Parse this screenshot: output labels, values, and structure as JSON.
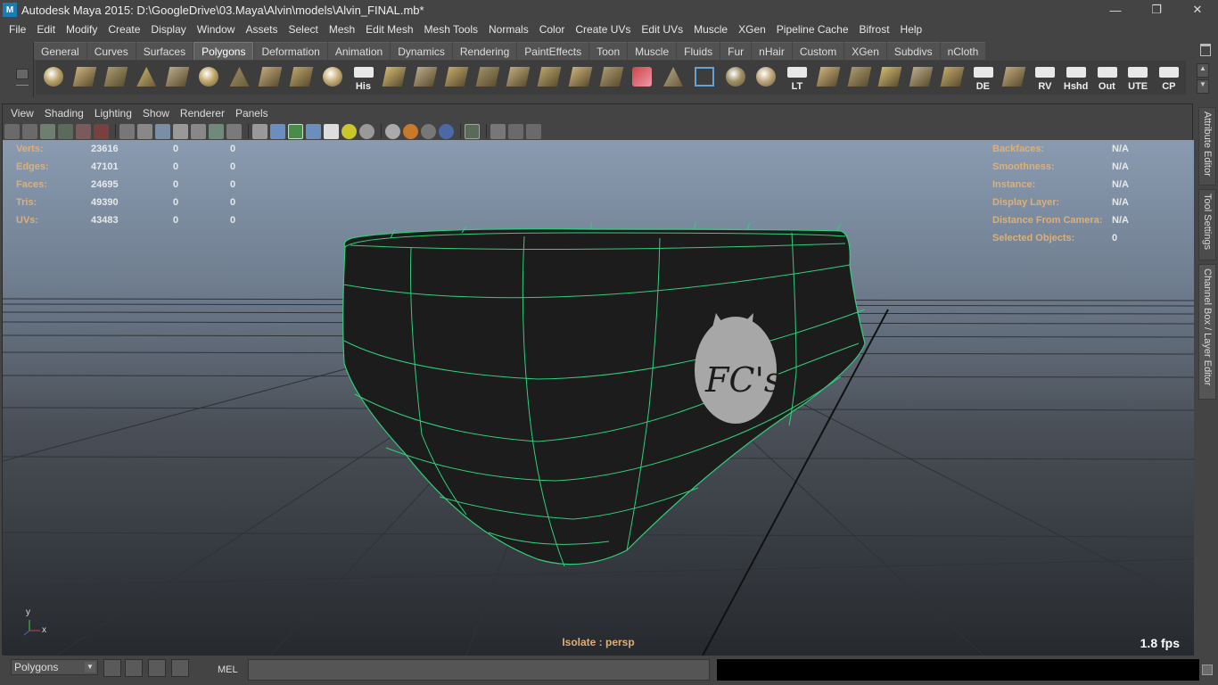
{
  "window": {
    "title": "Autodesk Maya 2015: D:\\GoogleDrive\\03.Maya\\Alvin\\models\\Alvin_FINAL.mb*",
    "app_icon": "M"
  },
  "window_buttons": {
    "minimize": "—",
    "restore": "❐",
    "close": "✕"
  },
  "menubar": [
    "File",
    "Edit",
    "Modify",
    "Create",
    "Display",
    "Window",
    "Assets",
    "Select",
    "Mesh",
    "Edit Mesh",
    "Mesh Tools",
    "Normals",
    "Color",
    "Create UVs",
    "Edit UVs",
    "Muscle",
    "XGen",
    "Pipeline Cache",
    "Bifrost",
    "Help"
  ],
  "shelf": {
    "tabs": [
      "General",
      "Curves",
      "Surfaces",
      "Polygons",
      "Deformation",
      "Animation",
      "Dynamics",
      "Rendering",
      "PaintEffects",
      "Toon",
      "Muscle",
      "Fluids",
      "Fur",
      "nHair",
      "Custom",
      "XGen",
      "Subdivs",
      "nCloth"
    ],
    "active_tab": "Polygons",
    "icons": [
      {
        "name": "poly-sphere-icon",
        "label": ""
      },
      {
        "name": "poly-cube-icon",
        "label": ""
      },
      {
        "name": "poly-cylinder-icon",
        "label": ""
      },
      {
        "name": "poly-cone-icon",
        "label": ""
      },
      {
        "name": "poly-plane-icon",
        "label": ""
      },
      {
        "name": "poly-torus-icon",
        "label": ""
      },
      {
        "name": "poly-pyramid-icon",
        "label": ""
      },
      {
        "name": "poly-pipe-icon",
        "label": ""
      },
      {
        "name": "create-polygon-tool-icon",
        "label": ""
      },
      {
        "name": "poly-sphere-mesh-icon",
        "label": ""
      },
      {
        "name": "history-icon",
        "label": "His"
      },
      {
        "name": "extrude-icon",
        "label": ""
      },
      {
        "name": "bevel-icon",
        "label": ""
      },
      {
        "name": "bridge-icon",
        "label": ""
      },
      {
        "name": "append-polygon-icon",
        "label": ""
      },
      {
        "name": "split-polygon-icon",
        "label": ""
      },
      {
        "name": "insert-edge-loop-icon",
        "label": ""
      },
      {
        "name": "offset-edge-loop-icon",
        "label": ""
      },
      {
        "name": "sculpt-geometry-icon",
        "label": ""
      },
      {
        "name": "paint-tool-icon",
        "label": ""
      },
      {
        "name": "lattice-icon",
        "label": ""
      },
      {
        "name": "soft-select-icon",
        "label": ""
      },
      {
        "name": "symmetry-icon",
        "label": ""
      },
      {
        "name": "mirror-geometry-icon",
        "label": ""
      },
      {
        "name": "lt-icon",
        "label": "LT"
      },
      {
        "name": "planar-mapping-icon",
        "label": ""
      },
      {
        "name": "cylindrical-mapping-icon",
        "label": ""
      },
      {
        "name": "spherical-mapping-icon",
        "label": ""
      },
      {
        "name": "automatic-mapping-icon",
        "label": ""
      },
      {
        "name": "uv-texture-editor-icon",
        "label": ""
      },
      {
        "name": "de-icon",
        "label": "DE"
      },
      {
        "name": "uv-layout-icon",
        "label": ""
      },
      {
        "name": "rv-icon",
        "label": "RV"
      },
      {
        "name": "hshd-icon",
        "label": "Hshd"
      },
      {
        "name": "out-icon",
        "label": "Out"
      },
      {
        "name": "ute-icon",
        "label": "UTE"
      },
      {
        "name": "cp-icon",
        "label": "CP"
      }
    ]
  },
  "panel_menu": [
    "View",
    "Shading",
    "Lighting",
    "Show",
    "Renderer",
    "Panels"
  ],
  "hud_left": [
    {
      "label": "Verts:",
      "v1": "23616",
      "v2": "0",
      "v3": "0"
    },
    {
      "label": "Edges:",
      "v1": "47101",
      "v2": "0",
      "v3": "0"
    },
    {
      "label": "Faces:",
      "v1": "24695",
      "v2": "0",
      "v3": "0"
    },
    {
      "label": "Tris:",
      "v1": "49390",
      "v2": "0",
      "v3": "0"
    },
    {
      "label": "UVs:",
      "v1": "43483",
      "v2": "0",
      "v3": "0"
    }
  ],
  "hud_right": [
    {
      "label": "Backfaces:",
      "value": "N/A"
    },
    {
      "label": "Smoothness:",
      "value": "N/A"
    },
    {
      "label": "Instance:",
      "value": "N/A"
    },
    {
      "label": "Display Layer:",
      "value": "N/A"
    },
    {
      "label": "Distance From Camera:",
      "value": "N/A"
    },
    {
      "label": "Selected Objects:",
      "value": "0"
    }
  ],
  "viewport": {
    "isolate_text": "Isolate : persp",
    "fps": "1.8 fps",
    "logo_text": "FC's",
    "axis_x": "x",
    "axis_y": "y"
  },
  "side_tabs": [
    "Attribute Editor",
    "Tool Settings",
    "Channel Box / Layer Editor"
  ],
  "statusbar": {
    "selection_mode": "Polygons",
    "mel_label": "MEL",
    "command_value": "",
    "output_value": ""
  },
  "colors": {
    "hud_label": "#dbb07a",
    "wireframe": "#2fd07a",
    "mesh": "#1b1b1b",
    "shelf_active_tab": "#5d5d5d"
  }
}
